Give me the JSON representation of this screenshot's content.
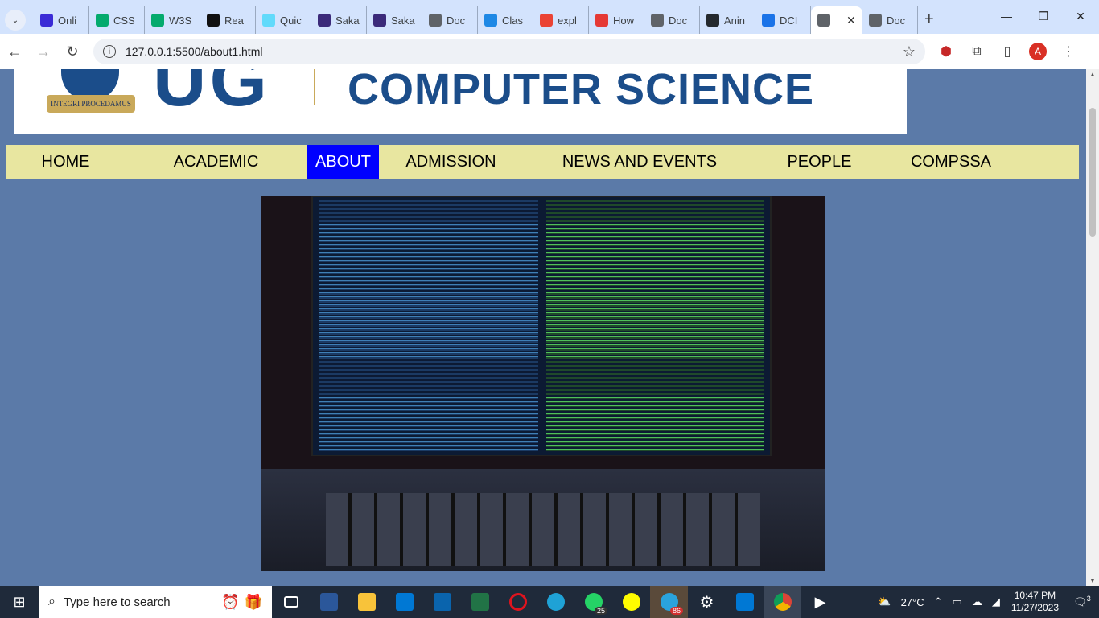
{
  "browser": {
    "tabs": [
      {
        "label": "Onli",
        "icon": "pen-icon",
        "color": "#3a2bd6"
      },
      {
        "label": "CSS",
        "icon": "w3-icon",
        "color": "#04aa6d"
      },
      {
        "label": "W3S",
        "icon": "w3-icon",
        "color": "#04aa6d"
      },
      {
        "label": "Rea",
        "icon": "r-icon",
        "color": "#111111"
      },
      {
        "label": "Quic",
        "icon": "react-icon",
        "color": "#61dafb"
      },
      {
        "label": "Saka",
        "icon": "crest-icon",
        "color": "#3b2a7a"
      },
      {
        "label": "Saka",
        "icon": "crest-icon",
        "color": "#3b2a7a"
      },
      {
        "label": "Doc",
        "icon": "globe-icon",
        "color": "#5f6368"
      },
      {
        "label": "Clas",
        "icon": "classroom-icon",
        "color": "#1e88e5"
      },
      {
        "label": "expl",
        "icon": "google-icon",
        "color": "#ea4335"
      },
      {
        "label": "How",
        "icon": "pin-icon",
        "color": "#e53935"
      },
      {
        "label": "Doc",
        "icon": "globe-icon",
        "color": "#5f6368"
      },
      {
        "label": "Anin",
        "icon": "github-icon",
        "color": "#24292e"
      },
      {
        "label": "DCI",
        "icon": "doc-icon",
        "color": "#1a73e8"
      },
      {
        "label": "",
        "icon": "globe-icon",
        "color": "#5f6368",
        "active": true
      },
      {
        "label": "Doc",
        "icon": "globe-icon",
        "color": "#5f6368"
      }
    ],
    "url": "127.0.0.1:5500/about1.html",
    "avatar_letter": "A"
  },
  "header": {
    "crest_motto": "INTEGRI PROCEDAMUS",
    "logo_letters": "UG",
    "department": "COMPUTER SCIENCE"
  },
  "nav": {
    "items": [
      {
        "label": "HOME"
      },
      {
        "label": "ACADEMIC"
      },
      {
        "label": "ABOUT",
        "active": true
      },
      {
        "label": "ADMISSION"
      },
      {
        "label": "NEWS AND EVENTS"
      },
      {
        "label": "PEOPLE"
      },
      {
        "label": "COMPSSA"
      }
    ],
    "active_color": "#0000ff",
    "bar_color": "#e8e6a0"
  },
  "page": {
    "background": "#5b7aa8"
  },
  "taskbar": {
    "search_placeholder": "Type here to search",
    "whatsapp_badge": "25",
    "telegram_badge": "86",
    "temperature": "27°C",
    "time": "10:47 PM",
    "date": "11/27/2023",
    "notifications": "3"
  }
}
